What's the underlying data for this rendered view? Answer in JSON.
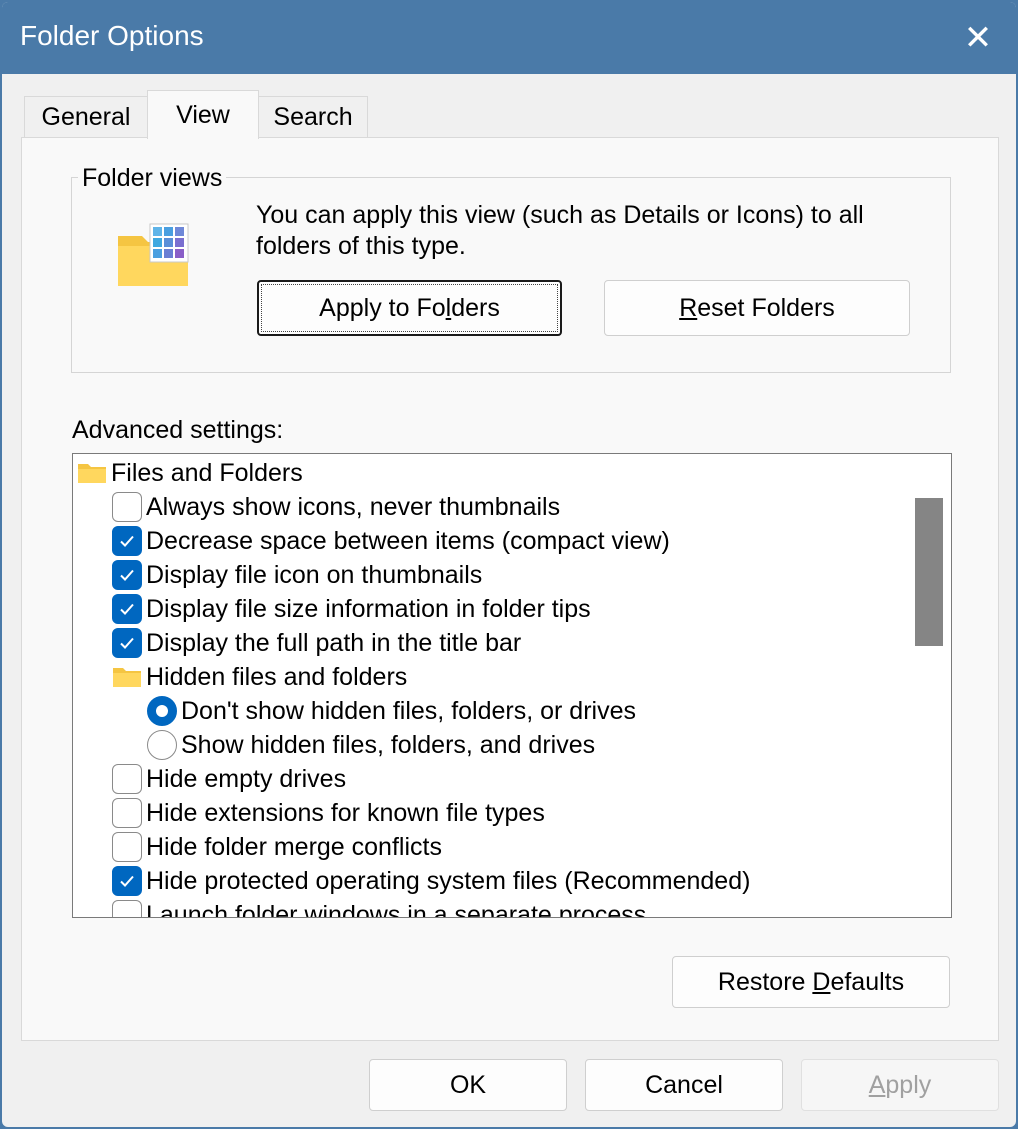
{
  "window": {
    "title": "Folder Options",
    "close_glyph": "✕"
  },
  "tabs": [
    {
      "label": "General",
      "active": false
    },
    {
      "label": "View",
      "active": true
    },
    {
      "label": "Search",
      "active": false
    }
  ],
  "folder_views": {
    "label": "Folder views",
    "description": "You can apply this view (such as Details or Icons) to all folders of this type.",
    "apply_button": {
      "pre": "Apply to Fo",
      "key": "l",
      "post": "ders"
    },
    "reset_button": {
      "pre": "",
      "key": "R",
      "post": "eset Folders"
    }
  },
  "advanced": {
    "label": "Advanced settings:",
    "items": [
      {
        "type": "folder",
        "label": "Files and Folders",
        "level": 0
      },
      {
        "type": "checkbox",
        "label": "Always show icons, never thumbnails",
        "checked": false,
        "level": 1
      },
      {
        "type": "checkbox",
        "label": "Decrease space between items (compact view)",
        "checked": true,
        "level": 1
      },
      {
        "type": "checkbox",
        "label": "Display file icon on thumbnails",
        "checked": true,
        "level": 1
      },
      {
        "type": "checkbox",
        "label": "Display file size information in folder tips",
        "checked": true,
        "level": 1
      },
      {
        "type": "checkbox",
        "label": "Display the full path in the title bar",
        "checked": true,
        "level": 1
      },
      {
        "type": "folder",
        "label": "Hidden files and folders",
        "level": 1
      },
      {
        "type": "radio",
        "label": "Don't show hidden files, folders, or drives",
        "checked": true,
        "level": 2
      },
      {
        "type": "radio",
        "label": "Show hidden files, folders, and drives",
        "checked": false,
        "level": 2
      },
      {
        "type": "checkbox",
        "label": "Hide empty drives",
        "checked": false,
        "level": 1
      },
      {
        "type": "checkbox",
        "label": "Hide extensions for known file types",
        "checked": false,
        "level": 1
      },
      {
        "type": "checkbox",
        "label": "Hide folder merge conflicts",
        "checked": false,
        "level": 1
      },
      {
        "type": "checkbox",
        "label": "Hide protected operating system files (Recommended)",
        "checked": true,
        "level": 1
      },
      {
        "type": "checkbox",
        "label": "Launch folder windows in a separate process",
        "checked": false,
        "level": 1
      }
    ]
  },
  "restore_button": {
    "pre": "Restore ",
    "key": "D",
    "post": "efaults"
  },
  "footer": {
    "ok": "OK",
    "cancel": "Cancel",
    "apply": {
      "pre": "",
      "key": "A",
      "post": "pply",
      "disabled": true
    }
  },
  "colors": {
    "titlebar": "#4a7aa8",
    "accent": "#0067c0"
  }
}
